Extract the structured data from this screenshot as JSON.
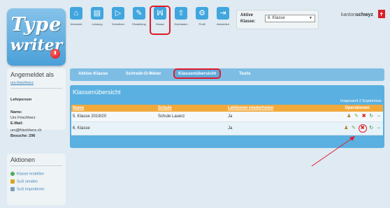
{
  "logo": {
    "line1": "Type",
    "line2": "writer"
  },
  "toolbar": [
    {
      "label": "Übersicht",
      "icon": "home-icon",
      "glyph": "⌂"
    },
    {
      "label": "Leistung",
      "icon": "chart-icon",
      "glyph": "▤"
    },
    {
      "label": "Schreiben",
      "icon": "play-icon",
      "glyph": "▷"
    },
    {
      "label": "Einstellung",
      "icon": "wrench-icon",
      "glyph": "✎"
    },
    {
      "label": "Klasse",
      "icon": "people-icon",
      "glyph": "ꟽ",
      "active": true
    },
    {
      "label": "Hochladen",
      "icon": "upload-icon",
      "glyph": "⇧"
    },
    {
      "label": "Profil",
      "icon": "gear-icon",
      "glyph": "⚙"
    },
    {
      "label": "Abmelden",
      "icon": "logout-icon",
      "glyph": "⇥"
    }
  ],
  "class_select": {
    "label_line1": "Aktive",
    "label_line2": "Klasse:",
    "value": "6. Klasse"
  },
  "brand": {
    "prefix": "kanton",
    "suffix": "schwyz"
  },
  "login": {
    "heading": "Angemeldet als",
    "username": "urs.frischherz",
    "role": "Lehrperson",
    "name_label": "Name:",
    "name_value": "Urs Frischherz",
    "email_label": "E-Mail:",
    "email_value": "urs@frischherz.ch",
    "visits": "Besuche: 296"
  },
  "aktionen": {
    "heading": "Aktionen",
    "items": [
      "Klasse erstellen",
      "SuS senden",
      "SuS importieren"
    ]
  },
  "tabs": [
    {
      "label": "Aktive Klasse"
    },
    {
      "label": "Schreib-O-Meter"
    },
    {
      "label": "Klassenübersicht",
      "active": true
    },
    {
      "label": "Tests"
    }
  ],
  "panel": {
    "title": "Klassenübersicht",
    "result_count": "Insgesamt 2 Ergebnisse",
    "columns": [
      "Name",
      "Schule",
      "Lektionen wiederholen",
      "Operationen"
    ],
    "rows": [
      {
        "name": "5. Klasse 2019/20",
        "school": "Schule Lauerz",
        "repeat": "Ja"
      },
      {
        "name": "6. Klasse",
        "school": "",
        "repeat": "Ja"
      }
    ]
  },
  "colors": {
    "accent": "#41a6de",
    "tab_bar": "#7dbde4",
    "panel": "#5ab0e0",
    "header_row": "#f2a93c",
    "highlight": "#e11b2b"
  }
}
